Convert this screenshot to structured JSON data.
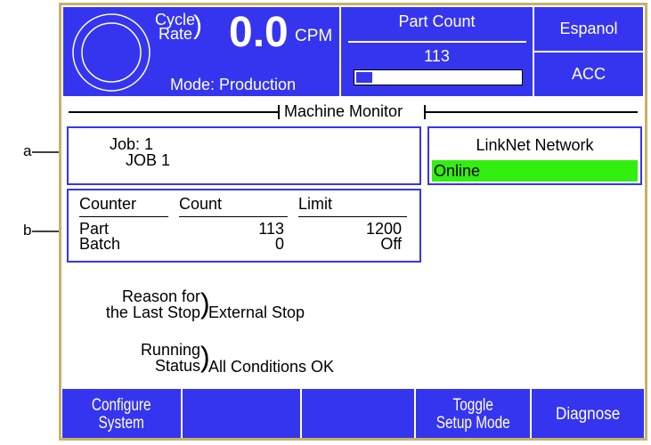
{
  "header": {
    "cycle_rate_line1": "Cycle",
    "cycle_rate_line2": "Rate",
    "rate_value": "0.0",
    "rate_unit": "CPM",
    "mode_label": "Mode: Production",
    "part_count_label": "Part Count",
    "part_count_value": "113",
    "part_count_progress": 0.094,
    "language_button": "Espanol",
    "acc_button": "ACC"
  },
  "section_title": "Machine Monitor",
  "job": {
    "label": "Job: 1",
    "name": "JOB 1"
  },
  "network": {
    "title": "LinkNet Network",
    "status": "Online"
  },
  "counters": {
    "headers": [
      "Counter",
      "Count",
      "Limit"
    ],
    "rows": [
      {
        "counter": "Part",
        "count": "113",
        "limit": "1200"
      },
      {
        "counter": "Batch",
        "count": "0",
        "limit": "Off"
      }
    ]
  },
  "reason": {
    "label_line1": "Reason for",
    "label_line2": "the Last Stop",
    "value": "External Stop"
  },
  "running": {
    "label_line1": "Running",
    "label_line2": "Status",
    "value": "All Conditions OK"
  },
  "annotations": {
    "a": "a",
    "b": "b"
  },
  "footer_buttons": {
    "configure_line1": "Configure",
    "configure_line2": "System",
    "toggle_line1": "Toggle",
    "toggle_line2": "Setup Mode",
    "diagnose": "Diagnose"
  },
  "colors": {
    "panel_blue": "#3535f0",
    "online_green": "#33ee11",
    "frame_gold": "#c8b26a"
  }
}
